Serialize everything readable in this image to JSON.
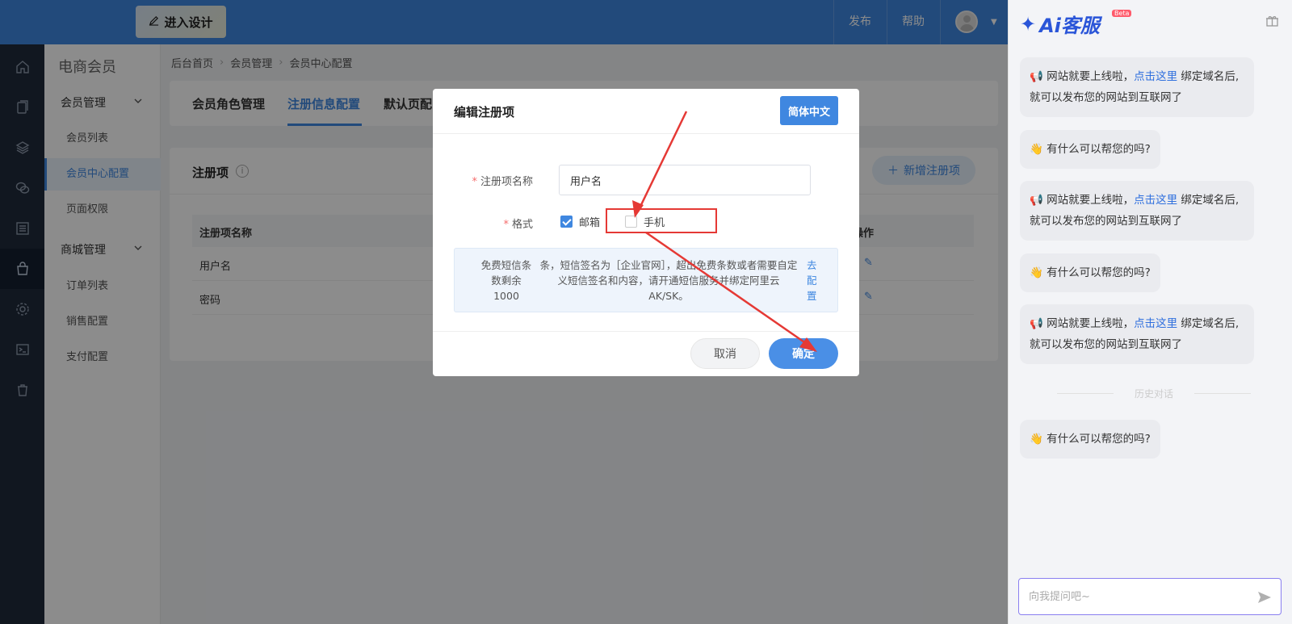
{
  "topbar": {
    "design_button": "进入设计",
    "publish": "发布",
    "help": "帮助"
  },
  "subnav": {
    "title": "电商会员",
    "group1": "会员管理",
    "group1_items": [
      "会员列表",
      "会员中心配置",
      "页面权限"
    ],
    "group2": "商城管理",
    "group2_items": [
      "订单列表",
      "销售配置",
      "支付配置"
    ]
  },
  "breadcrumb": [
    "后台首页",
    "会员管理",
    "会员中心配置"
  ],
  "tabs": [
    "会员角色管理",
    "注册信息配置",
    "默认页配"
  ],
  "card": {
    "title": "注册项",
    "add_button": "新增注册项",
    "col_name": "注册项名称",
    "col_ops": "操作",
    "rows": [
      "用户名",
      "密码"
    ]
  },
  "modal": {
    "title": "编辑注册项",
    "lang_button": "简体中文",
    "name_label": "注册项名称",
    "name_value": "用户名",
    "format_label": "格式",
    "opt_email": "邮箱",
    "opt_phone": "手机",
    "notice_left": "免费短信条数剩余1000",
    "notice_mid": "条，短信签名为［企业官网］，超出免费条数或者需要自定义短信签名和内容，请开通短信服务并绑定阿里云AK/SK。",
    "notice_link": "去配置",
    "cancel": "取消",
    "ok": "确定"
  },
  "ai": {
    "logo": "Ai客服",
    "beta": "Beta",
    "msg_launch_a": "网站就要上线啦，",
    "msg_launch_link": "点击这里",
    "msg_launch_b": "绑定域名后,就可以发布您的网站到互联网了",
    "msg_help": "有什么可以帮您的吗?",
    "history": "历史对话",
    "input_placeholder": "向我提问吧~"
  }
}
